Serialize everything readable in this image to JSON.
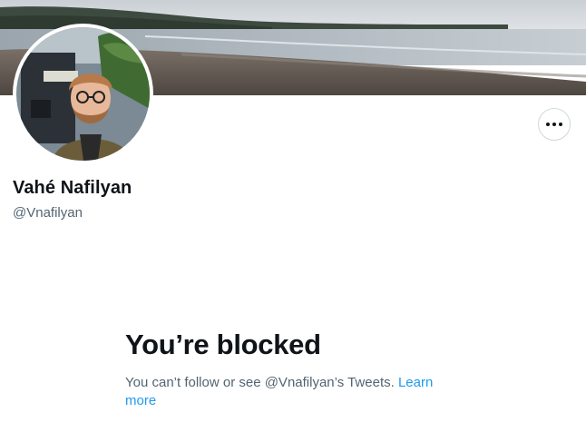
{
  "profile": {
    "display_name": "Vahé Nafilyan",
    "handle": "@Vnafilyan"
  },
  "blocked": {
    "title": "You’re blocked",
    "message": "You can’t follow or see @Vnafilyan’s Tweets.",
    "learn_more": "Learn more"
  },
  "icons": {
    "more": "more-horizontal-icon"
  },
  "colors": {
    "link": "#1d9bf0",
    "secondary_text": "#536471",
    "primary_text": "#0f1419",
    "button_border": "#cfd9de"
  }
}
